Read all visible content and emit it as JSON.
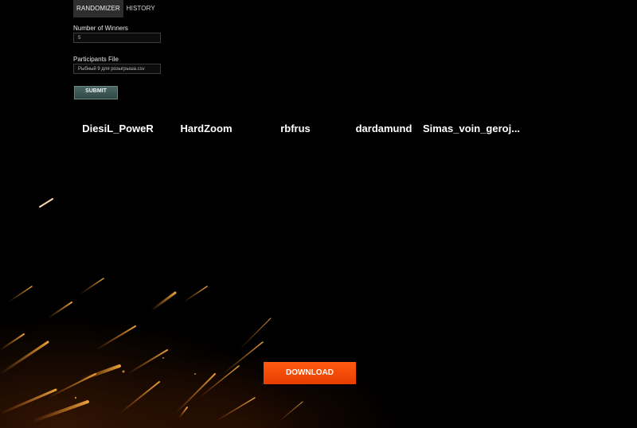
{
  "tabs": [
    {
      "label": "RANDOMIZER",
      "active": true
    },
    {
      "label": "HISTORY",
      "active": false
    }
  ],
  "form": {
    "winners_label": "Number of Winners",
    "winners_value": "5",
    "file_label": "Participants File",
    "file_value": "Рыбный 9 для розыгрыша.csv",
    "submit_label": "SUBMIT"
  },
  "winners": [
    "DiesiL_PoweR",
    "HardZoom",
    "rbfrus",
    "dardamund",
    "Simas_voin_geroj..."
  ],
  "download_label": "DOWNLOAD",
  "colors": {
    "background": "#000000",
    "accent": "#ff5a10",
    "submit": "#3f5a58",
    "tab_active": "#2e2e2e"
  }
}
